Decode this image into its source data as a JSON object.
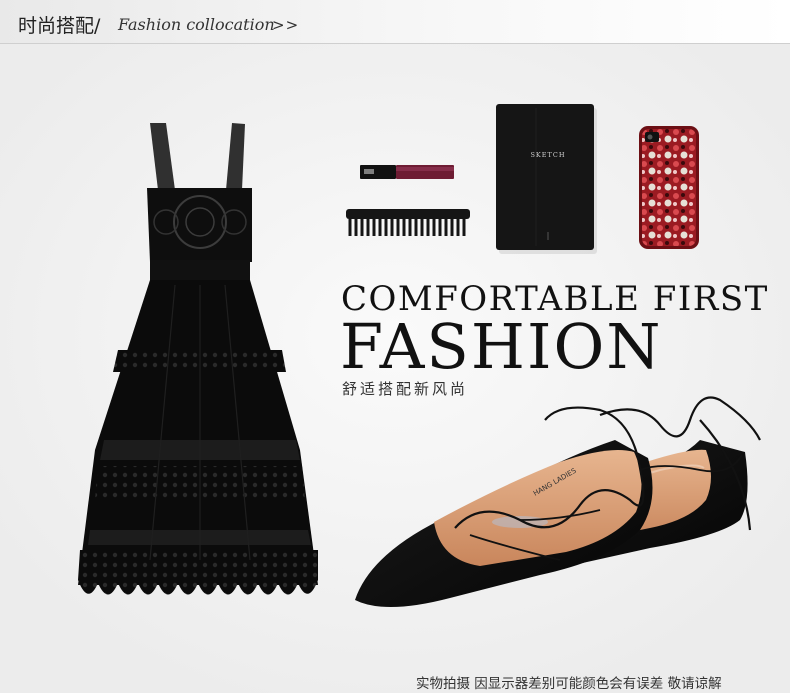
{
  "header": {
    "title_cn": "时尚搭配/",
    "title_en": "Fashion collocation",
    "more": ">>"
  },
  "products": {
    "notebook_label": "SKETCH",
    "headline_line1": "COMFORTABLE FIRST",
    "headline_line2": "FASHION",
    "tagline": "舒适搭配新风尚",
    "insole_text": "HANG LADIES"
  },
  "footer": {
    "notice": "实物拍摄 因显示器差别可能颜色会有误差 敬请谅解"
  },
  "icons": [
    "dress-image",
    "lipstick-image",
    "comb-image",
    "notebook-image",
    "phone-case-image",
    "shoes-image"
  ]
}
